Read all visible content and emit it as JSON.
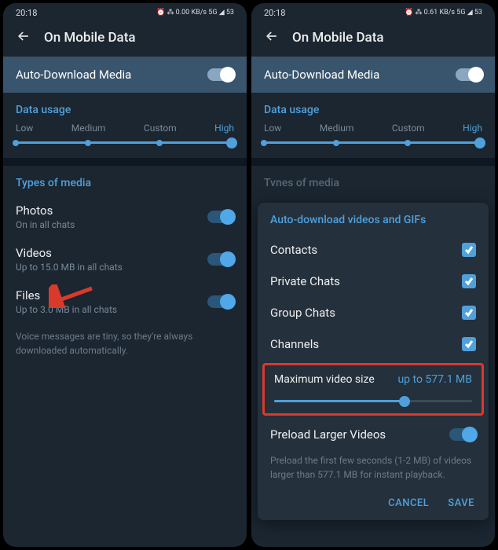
{
  "status": {
    "time": "20:18",
    "indicators": "⏰ ⁂ 0.00 KB/s 5G ◢ 53"
  },
  "header": {
    "title": "On Mobile Data"
  },
  "auto_download": {
    "label": "Auto-Download Media"
  },
  "data_usage": {
    "title": "Data usage",
    "levels": [
      "Low",
      "Medium",
      "Custom",
      "High"
    ],
    "active": "High"
  },
  "types_media": {
    "title": "Types of media",
    "photos": {
      "label": "Photos",
      "sub": "On in all chats"
    },
    "videos": {
      "label": "Videos",
      "sub": "Up to 15.0 MB in all chats"
    },
    "files": {
      "label": "Files",
      "sub": "Up to 3.0 MB in all chats"
    },
    "note": "Voice messages are tiny, so they're always downloaded automatically."
  },
  "right_status": {
    "time": "20:18",
    "indicators": "⏰ ⁂ 0.61 KB/s 5G ◢ 53"
  },
  "modal": {
    "title": "Auto-download videos and GIFs",
    "items": [
      "Contacts",
      "Private Chats",
      "Group Chats",
      "Channels"
    ],
    "max_size": {
      "label": "Maximum video size",
      "value": "up to 577.1 MB"
    },
    "preload": {
      "label": "Preload Larger Videos",
      "note": "Preload the first few seconds (1-2 MB) of videos larger than 577.1 MB for instant playback."
    },
    "actions": {
      "cancel": "CANCEL",
      "save": "SAVE"
    }
  },
  "truncated": "Tvnes of media"
}
